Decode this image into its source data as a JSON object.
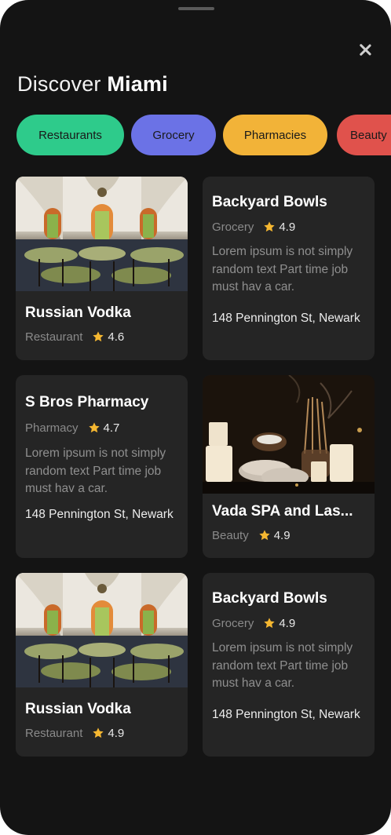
{
  "header": {
    "title_prefix": "Discover",
    "title_city": "Miami"
  },
  "colors": {
    "background": "#141414",
    "card": "#252525",
    "star": "#f5b731"
  },
  "categories": [
    {
      "label": "Restaurants",
      "color": "#2ecb8b"
    },
    {
      "label": "Grocery",
      "color": "#6b72e6"
    },
    {
      "label": "Pharmacies",
      "color": "#f2b338"
    },
    {
      "label": "Beauty",
      "color": "#e0524c"
    }
  ],
  "places": [
    {
      "name": "Russian Vodka",
      "category": "Restaurant",
      "rating": "4.6",
      "image": "restaurant-photo"
    },
    {
      "name": "Backyard Bowls",
      "category": "Grocery",
      "rating": "4.9",
      "description": "Lorem ipsum is not simply random text Part time job must hav a car.",
      "address": "148 Pennington St, Newark"
    },
    {
      "name": "S Bros Pharmacy",
      "category": "Pharmacy",
      "rating": "4.7",
      "description": "Lorem ipsum is not simply random text Part time job must hav a car.",
      "address": "148 Pennington St, Newark"
    },
    {
      "name": "Vada SPA and Las...",
      "category": "Beauty",
      "rating": "4.9",
      "image": "spa-photo"
    },
    {
      "name": "Russian Vodka",
      "category": "Restaurant",
      "rating": "4.9",
      "image": "restaurant-photo"
    },
    {
      "name": "Backyard Bowls",
      "category": "Grocery",
      "rating": "4.9",
      "description": "Lorem ipsum is not simply random text Part time job must hav a car.",
      "address": "148 Pennington St, Newark"
    }
  ]
}
